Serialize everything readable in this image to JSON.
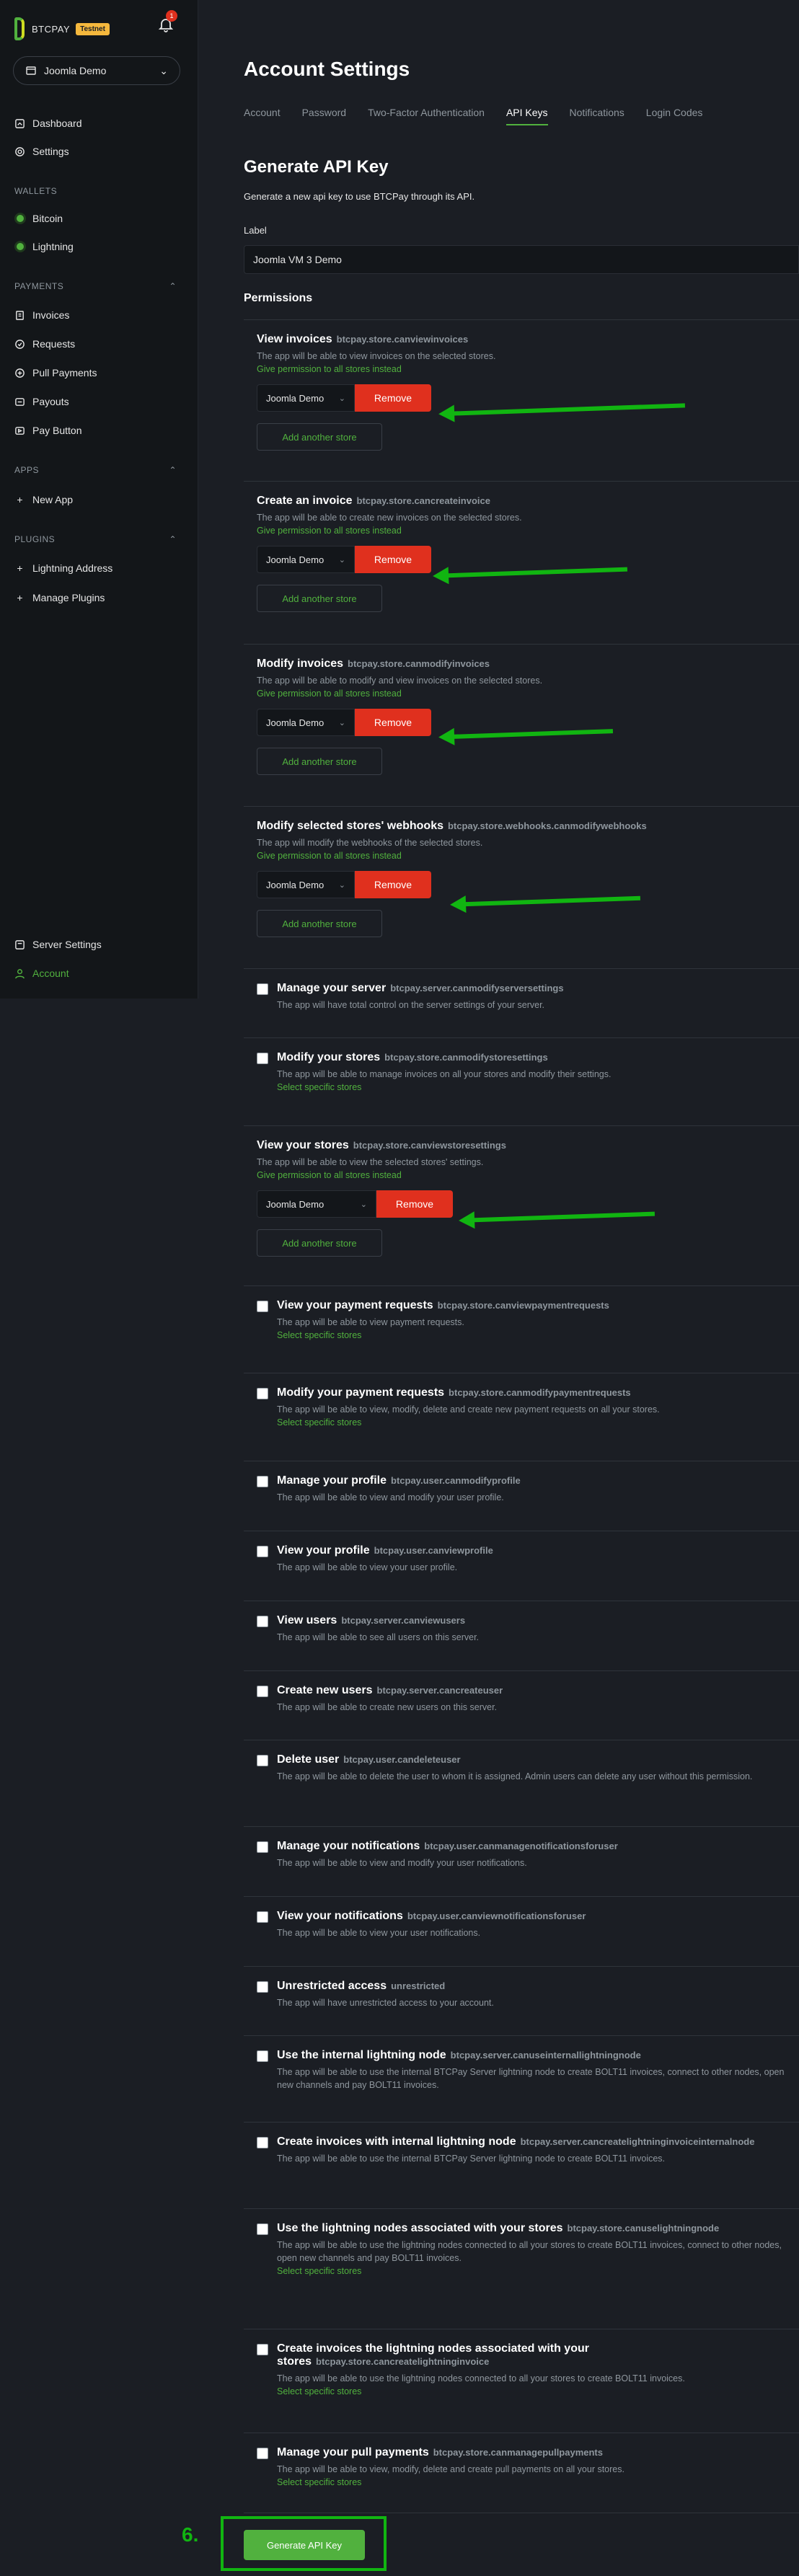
{
  "brand": {
    "name": "BTCPAY",
    "badge": "Testnet",
    "notifications": "1"
  },
  "store_selector": {
    "name": "Joomla Demo"
  },
  "sidebar": {
    "top": [
      {
        "label": "Dashboard"
      },
      {
        "label": "Settings"
      }
    ],
    "wallets_head": "WALLETS",
    "wallets": [
      {
        "label": "Bitcoin"
      },
      {
        "label": "Lightning"
      }
    ],
    "payments_head": "PAYMENTS",
    "payments": [
      {
        "label": "Invoices"
      },
      {
        "label": "Requests"
      },
      {
        "label": "Pull Payments"
      },
      {
        "label": "Payouts"
      },
      {
        "label": "Pay Button"
      }
    ],
    "apps_head": "APPS",
    "apps": [
      {
        "label": "New App"
      }
    ],
    "plugins_head": "PLUGINS",
    "plugins": [
      {
        "label": "Lightning Address"
      },
      {
        "label": "Manage Plugins"
      }
    ],
    "bottom": [
      {
        "label": "Server Settings"
      },
      {
        "label": "Account"
      }
    ]
  },
  "page": {
    "title": "Account Settings",
    "tabs": [
      "Account",
      "Password",
      "Two-Factor Authentication",
      "API Keys",
      "Notifications",
      "Login Codes"
    ],
    "section_title": "Generate API Key",
    "subtitle": "Generate a new api key to use BTCPay through its API.",
    "label_caption": "Label",
    "label_value": "Joomla VM 3 Demo",
    "permissions_title": "Permissions"
  },
  "store_perms": [
    {
      "name": "View invoices",
      "code": "btcpay.store.canviewinvoices",
      "desc": "The app will be able to view invoices on the selected stores.",
      "link": "Give permission to all stores instead",
      "store": "Joomla Demo",
      "remove": "Remove",
      "add": "Add another store"
    },
    {
      "name": "Create an invoice",
      "code": "btcpay.store.cancreateinvoice",
      "desc": "The app will be able to create new invoices on the selected stores.",
      "link": "Give permission to all stores instead",
      "store": "Joomla Demo",
      "remove": "Remove",
      "add": "Add another store"
    },
    {
      "name": "Modify invoices",
      "code": "btcpay.store.canmodifyinvoices",
      "desc": "The app will be able to modify and view invoices on the selected stores.",
      "link": "Give permission to all stores instead",
      "store": "Joomla Demo",
      "remove": "Remove",
      "add": "Add another store"
    },
    {
      "name": "Modify selected stores' webhooks",
      "code": "btcpay.store.webhooks.canmodifywebhooks",
      "desc": "The app will modify the webhooks of the selected stores.",
      "link": "Give permission to all stores instead",
      "store": "Joomla Demo",
      "remove": "Remove",
      "add": "Add another store"
    }
  ],
  "checkbox_perms_a": [
    {
      "name": "Manage your server",
      "code": "btcpay.server.canmodifyserversettings",
      "desc": "The app will have total control on the server settings of your server.",
      "link": ""
    },
    {
      "name": "Modify your stores",
      "code": "btcpay.store.canmodifystoresettings",
      "desc": "The app will be able to manage invoices on all your stores and modify their settings.",
      "link": "Select specific stores"
    }
  ],
  "view_stores": {
    "name": "View your stores",
    "code": "btcpay.store.canviewstoresettings",
    "desc": "The app will be able to view the selected stores' settings.",
    "link": "Give permission to all stores instead",
    "store": "Joomla Demo",
    "remove": "Remove",
    "add": "Add another store"
  },
  "checkbox_perms_b": [
    {
      "name": "View your payment requests",
      "code": "btcpay.store.canviewpaymentrequests",
      "desc": "The app will be able to view payment requests.",
      "link": "Select specific stores"
    },
    {
      "name": "Modify your payment requests",
      "code": "btcpay.store.canmodifypaymentrequests",
      "desc": "The app will be able to view, modify, delete and create new payment requests on all your stores.",
      "link": "Select specific stores"
    },
    {
      "name": "Manage your profile",
      "code": "btcpay.user.canmodifyprofile",
      "desc": "The app will be able to view and modify your user profile.",
      "link": ""
    },
    {
      "name": "View your profile",
      "code": "btcpay.user.canviewprofile",
      "desc": "The app will be able to view your user profile.",
      "link": ""
    },
    {
      "name": "View users",
      "code": "btcpay.server.canviewusers",
      "desc": "The app will be able to see all users on this server.",
      "link": ""
    },
    {
      "name": "Create new users",
      "code": "btcpay.server.cancreateuser",
      "desc": "The app will be able to create new users on this server.",
      "link": ""
    },
    {
      "name": "Delete user",
      "code": "btcpay.user.candeleteuser",
      "desc": "The app will be able to delete the user to whom it is assigned. Admin users can delete any user without this permission.",
      "link": ""
    },
    {
      "name": "Manage your notifications",
      "code": "btcpay.user.canmanagenotificationsforuser",
      "desc": "The app will be able to view and modify your user notifications.",
      "link": ""
    },
    {
      "name": "View your notifications",
      "code": "btcpay.user.canviewnotificationsforuser",
      "desc": "The app will be able to view your user notifications.",
      "link": ""
    },
    {
      "name": "Unrestricted access",
      "code": "unrestricted",
      "desc": "The app will have unrestricted access to your account.",
      "link": ""
    },
    {
      "name": "Use the internal lightning node",
      "code": "btcpay.server.canuseinternallightningnode",
      "desc": "The app will be able to use the internal BTCPay Server lightning node to create BOLT11 invoices, connect to other nodes, open new channels and pay BOLT11 invoices.",
      "link": ""
    },
    {
      "name": "Create invoices with internal lightning node",
      "code": "btcpay.server.cancreatelightninginvoiceinternalnode",
      "desc": "The app will be able to use the internal BTCPay Server lightning node to create BOLT11 invoices.",
      "link": ""
    },
    {
      "name": "Use the lightning nodes associated with your stores",
      "code": "btcpay.store.canuselightningnode",
      "desc": "The app will be able to use the lightning nodes connected to all your stores to create BOLT11 invoices, connect to other nodes, open new channels and pay BOLT11 invoices.",
      "link": "Select specific stores"
    },
    {
      "name": "Create invoices the lightning nodes associated with your stores",
      "code": "btcpay.store.cancreatelightninginvoice",
      "desc": "The app will be able to use the lightning nodes connected to all your stores to create BOLT11 invoices.",
      "link": "Select specific stores"
    },
    {
      "name": "Manage your pull payments",
      "code": "btcpay.store.canmanagepullpayments",
      "desc": "The app will be able to view, modify, delete and create pull payments on all your stores.",
      "link": "Select specific stores"
    }
  ],
  "footer": {
    "step": "6.",
    "button": "Generate API Key"
  },
  "colors": {
    "accent": "#51b13e",
    "danger": "#e0301e",
    "annotation": "#11b511"
  }
}
